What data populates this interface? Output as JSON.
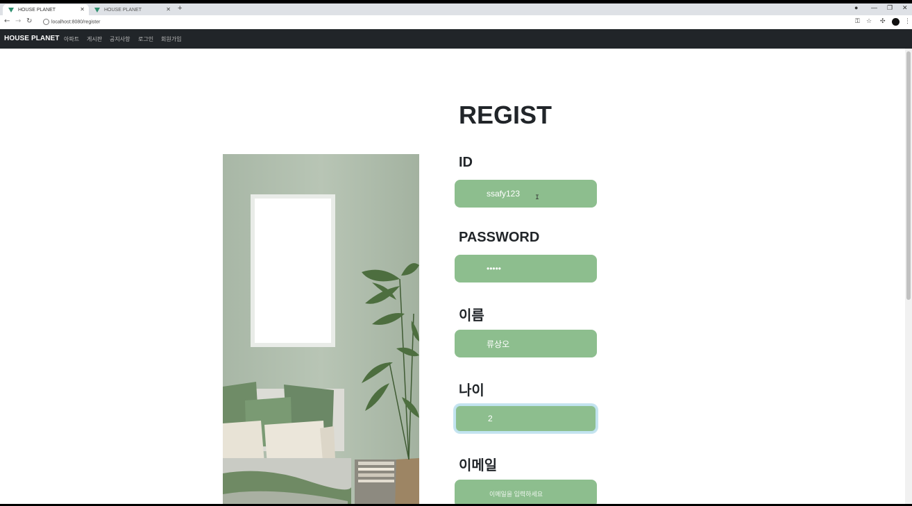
{
  "browser": {
    "tabs": [
      {
        "title": "HOUSE PLANET",
        "active": true
      },
      {
        "title": "HOUSE PLANET",
        "active": false
      }
    ],
    "url": "localhost:8080/register"
  },
  "navbar": {
    "brand": "HOUSE PLANET",
    "items": [
      "아파트",
      "게시판",
      "공지사항",
      "로그인",
      "회원가입"
    ]
  },
  "form": {
    "title": "REGIST",
    "fields": [
      {
        "label": "ID",
        "value": "ssafy123"
      },
      {
        "label": "PASSWORD",
        "value": "•••••"
      },
      {
        "label": "이름",
        "value": "류상오"
      },
      {
        "label": "나이",
        "value": "2"
      },
      {
        "label": "이메일",
        "placeholder": "이메일을 입력하세요"
      }
    ]
  },
  "colors": {
    "navbar": "#212529",
    "field": "#8dbe8e",
    "focus_ring": "#bfe3ef"
  }
}
